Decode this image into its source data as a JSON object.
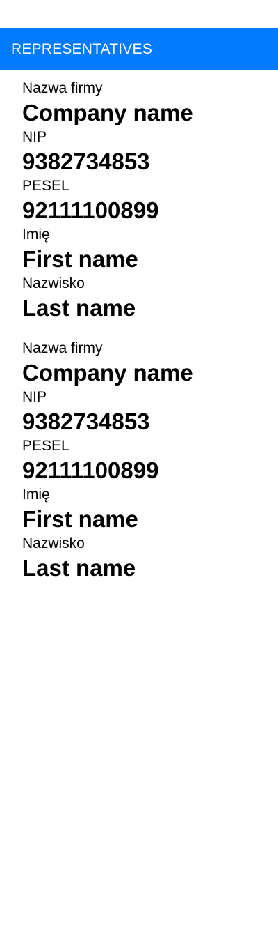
{
  "header": {
    "title": "REPRESENTATIVES"
  },
  "representatives": [
    {
      "company_label": "Nazwa firmy",
      "company_value": "Company name",
      "nip_label": "NIP",
      "nip_value": "9382734853",
      "pesel_label": "PESEL",
      "pesel_value": "92111100899",
      "first_name_label": "Imię",
      "first_name_value": "First name",
      "last_name_label": "Nazwisko",
      "last_name_value": "Last name"
    },
    {
      "company_label": "Nazwa firmy",
      "company_value": "Company name",
      "nip_label": "NIP",
      "nip_value": "9382734853",
      "pesel_label": "PESEL",
      "pesel_value": "92111100899",
      "first_name_label": "Imię",
      "first_name_value": "First name",
      "last_name_label": "Nazwisko",
      "last_name_value": "Last name"
    }
  ]
}
